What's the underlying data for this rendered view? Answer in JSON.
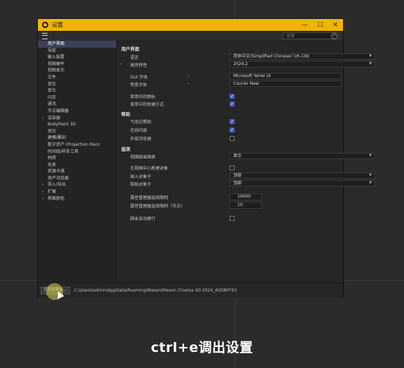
{
  "window": {
    "title": "设置"
  },
  "search": {
    "placeholder": "搜索"
  },
  "sidebar": {
    "items": [
      {
        "label": "用户界面",
        "active": true,
        "expandable": false
      },
      {
        "label": "导航",
        "expandable": false
      },
      {
        "label": "输入装置",
        "expandable": false
      },
      {
        "label": "视图硬件",
        "expandable": false
      },
      {
        "label": "视图显示",
        "expandable": false
      },
      {
        "label": "文件",
        "expandable": false
      },
      {
        "label": "单位",
        "expandable": false
      },
      {
        "label": "单位",
        "expandable": false
      },
      {
        "label": "内存",
        "expandable": false
      },
      {
        "label": "通讯",
        "expandable": false
      },
      {
        "label": "节点编辑器",
        "expandable": false
      },
      {
        "label": "渲染器",
        "expandable": true
      },
      {
        "label": "BodyPaint 3D",
        "expandable": false
      },
      {
        "label": "场次",
        "expandable": false
      },
      {
        "label": "建模/雕刻",
        "expandable": false
      },
      {
        "label": "数字资产 (Projection Man)",
        "expandable": false
      },
      {
        "label": "时间线/样条工具",
        "expandable": false
      },
      {
        "label": "材质",
        "expandable": false
      },
      {
        "label": "毛发",
        "expandable": false
      },
      {
        "label": "资源卡满",
        "expandable": false
      },
      {
        "label": "资产浏览器",
        "expandable": false
      },
      {
        "label": "导入/导出",
        "expandable": true
      },
      {
        "label": "扩展",
        "expandable": true
      },
      {
        "label": "界面颜色",
        "expandable": true
      }
    ]
  },
  "main": {
    "section_ui": "用户界面",
    "language_label": "语言",
    "language_value": "简体中文(Simplified Chinese) (zh-CN)",
    "highlight_label": "高亮特性",
    "highlight_value": "2024.2",
    "gui_font_label": "GUI 字体",
    "gui_font_value": "Microsoft YaHei UI",
    "mono_font_label": "等宽字体",
    "mono_font_value": "Courier New",
    "menu_icons_label": "菜单中的图标",
    "menu_shortcuts_label": "菜单中的快捷方式",
    "section_help": "帮助",
    "bubble_help_label": "气泡式帮助",
    "online_help_label": "在线内容",
    "external_browser_label": "外部浏览器",
    "section_selection": "选项",
    "viewport_label": "视图缺省图表",
    "viewport_value": "显示",
    "new_object_label": "在视图中心新建对象",
    "insert_object_label": "插入对象于",
    "insert_object_value": "顶部",
    "paste_object_label": "粘贴对象于",
    "paste_object_value": "顶部",
    "attr_limit_label": "属性管理器选择限制",
    "attr_limit_value": "10000",
    "attr_node_limit_label": "属性管理器选择限制（节点）",
    "attr_node_limit_value": "10",
    "script_autowrap_label": "脚本自动换行"
  },
  "footer": {
    "open_folder_label": "打开文件夹...",
    "path": "C:\\Users\\admin\\AppData\\Roaming\\Maxon\\Maxon Cinema 4D 2024_A5DBFF93"
  },
  "caption": "ctrl+e调出设置",
  "colors": {
    "titlebar": "#f0b400",
    "accent": "#4a5fc1",
    "active_item": "#3c4057"
  }
}
